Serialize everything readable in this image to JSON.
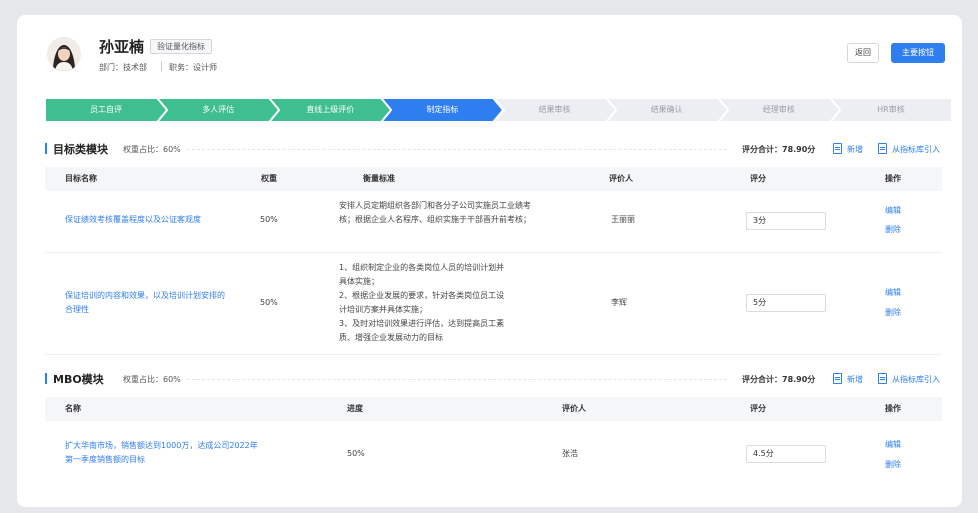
{
  "header": {
    "name": "孙亚楠",
    "tag": "验证量化指标",
    "dept": "部门：技术部",
    "job": "职务：设计师",
    "back_label": "返回",
    "primary_label": "主要按钮"
  },
  "steps": [
    {
      "label": "员工自评",
      "state": "done"
    },
    {
      "label": "多人评估",
      "state": "done"
    },
    {
      "label": "直线上级评价",
      "state": "done"
    },
    {
      "label": "制定指标",
      "state": "active"
    },
    {
      "label": "结果审核",
      "state": "todo"
    },
    {
      "label": "结果确认",
      "state": "todo"
    },
    {
      "label": "经理审核",
      "state": "todo"
    },
    {
      "label": "HR审核",
      "state": "todo"
    }
  ],
  "goal_section": {
    "title": "目标类模块",
    "weight": "权重占比：60%",
    "total": "评分合计：78.90分",
    "add_label": "新增",
    "import_label": "从指标库引入",
    "columns": [
      "目标名称",
      "权重",
      "衡量标准",
      "评价人",
      "评分",
      "操作"
    ],
    "rows": [
      {
        "name": "保证绩效考核覆盖程度以及公证客观度",
        "weight": "50%",
        "criteria": "安排人员定期组织各部门和各分子公司实施员工业绩考核；根据企业人名程序、组织实施于干部晋升前考核；",
        "evaluator": "王丽丽",
        "score": "3分",
        "edit": "编辑",
        "delete": "删除"
      },
      {
        "name": "保证培训的内容和效果，以及培训计划安排的合理性",
        "weight": "50%",
        "criteria_lines": [
          "1、组织制定企业的各类岗位人员的培训计划并",
          "具体实施；",
          "2、根据企业发展的要求，针对各类岗位员工设",
          "计培训方案并具体实施；",
          "3、及时对培训效果进行评估，达到提高员工素",
          "质、增强企业发展动力的目标"
        ],
        "evaluator": "李辉",
        "score": "5分",
        "edit": "编辑",
        "delete": "删除"
      }
    ]
  },
  "mbo_section": {
    "title": "MBO模块",
    "weight": "权重占比：60%",
    "total": "评分合计：78.90分",
    "add_label": "新增",
    "import_label": "从指标库引入",
    "columns": [
      "名称",
      "进度",
      "评价人",
      "评分",
      "操作"
    ],
    "rows": [
      {
        "name_lines": [
          "扩大华南市场，销售额达到1000万，达成公司2022年",
          "第一季度销售额的目标"
        ],
        "progress": "50%",
        "evaluator": "张浩",
        "score": "4.5分",
        "edit": "编辑",
        "delete": "删除"
      }
    ]
  },
  "colors": {
    "primary": "#2f7ef0",
    "step_done": "#3fbf8f",
    "step_todo": "#eceef1"
  }
}
